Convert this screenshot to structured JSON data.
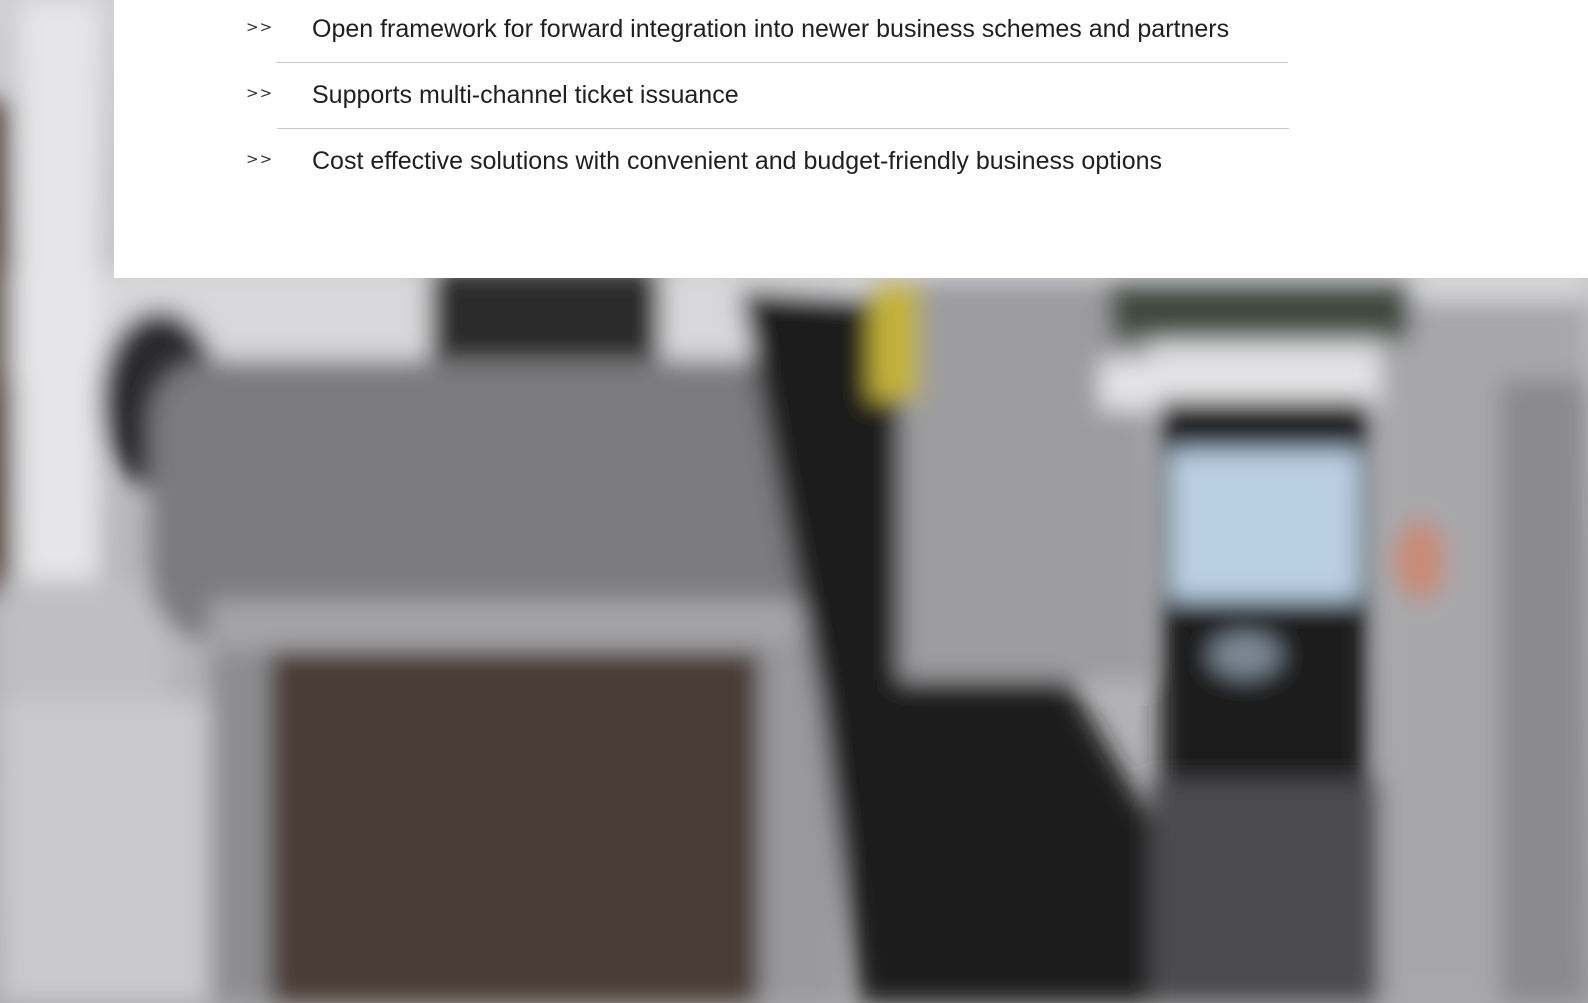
{
  "features": {
    "bullet": ">>",
    "items": [
      "Open framework for forward integration into newer business schemes and partners",
      "Supports multi-channel ticket issuance",
      "Cost effective solutions with convenient and budget-friendly business options"
    ]
  }
}
